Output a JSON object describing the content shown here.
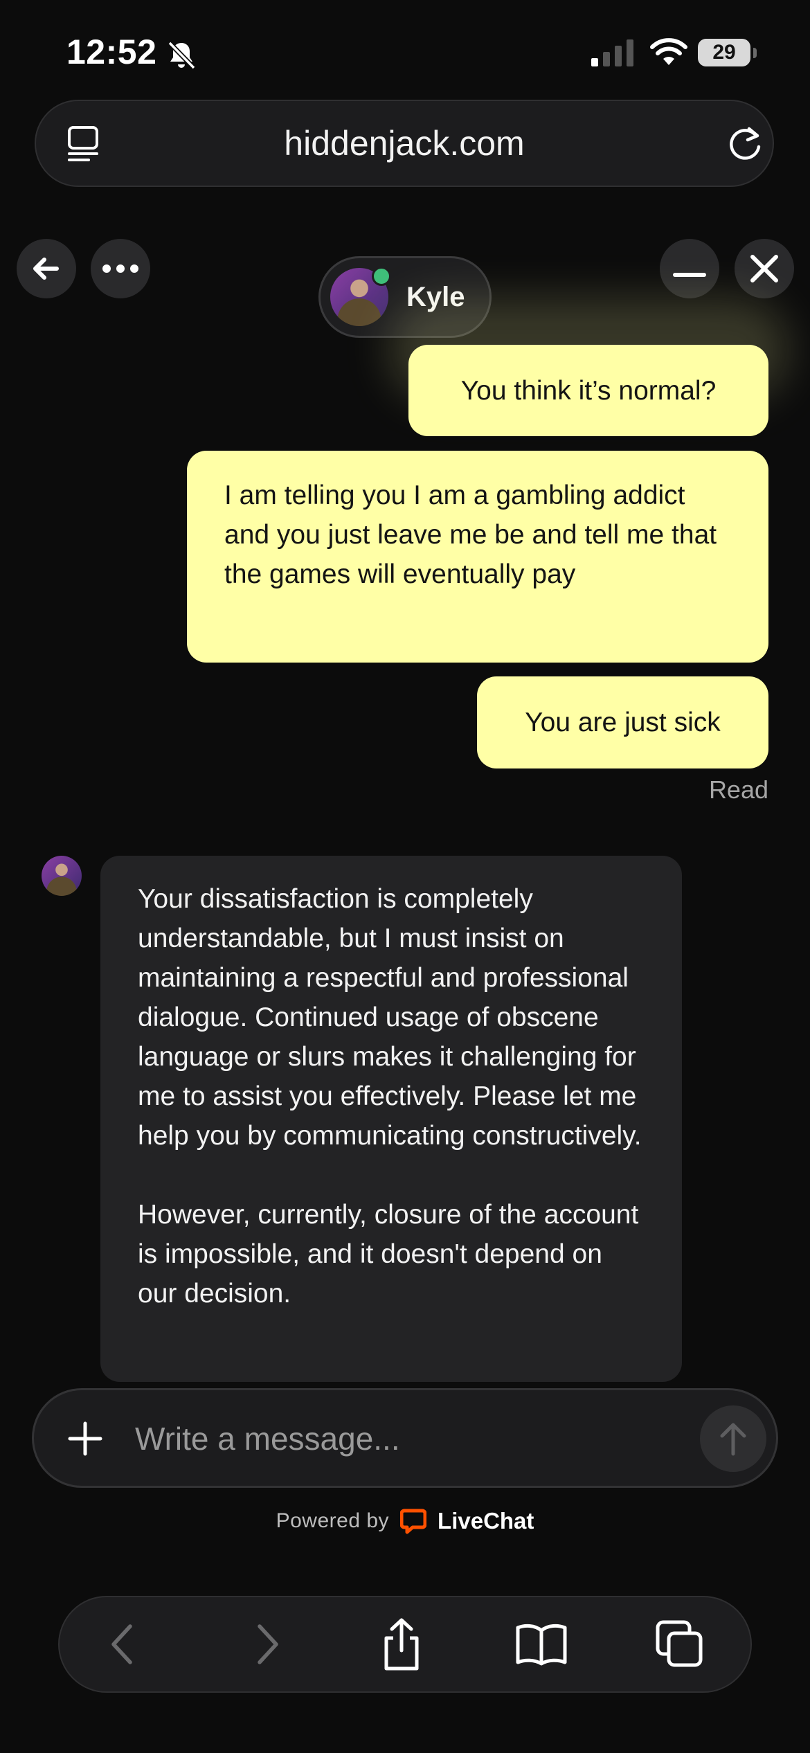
{
  "status_bar": {
    "time": "12:52",
    "battery": "29",
    "icons": [
      "bell-slash-icon",
      "cellular-signal-icon",
      "wifi-icon",
      "battery-icon"
    ]
  },
  "browser": {
    "url": "hiddenjack.com",
    "icons": [
      "tab-overview-icon",
      "reload-icon"
    ]
  },
  "chat_header": {
    "agent_name": "Kyle",
    "agent_status": "online",
    "icons": [
      "back-arrow-icon",
      "more-icon",
      "minimize-icon",
      "close-icon"
    ]
  },
  "messages": [
    {
      "from": "visitor",
      "text": "You think it’s normal?"
    },
    {
      "from": "visitor",
      "text": "I am telling you I am a gambling addict and you just leave me be and tell me that the games will eventually pay"
    },
    {
      "from": "visitor",
      "text": "You are just sick"
    },
    {
      "from": "agent",
      "paragraphs": [
        "Your dissatisfaction is completely understandable, but I must insist on maintaining a respectful and professional dialogue. Continued usage of obscene language or slurs makes it challenging for me to assist you effectively. Please let me help you by communicating constructively.",
        "However, currently, closure of the account is impossible, and it doesn't depend on our decision."
      ]
    }
  ],
  "read_receipt": "Read",
  "composer": {
    "placeholder": "Write a message...",
    "icons": [
      "plus-icon",
      "send-arrow-icon"
    ]
  },
  "footer": {
    "powered_by": "Powered by",
    "brand": "LiveChat",
    "brand_color": "#ff5100"
  },
  "toolbar": {
    "icons": [
      "back-icon",
      "forward-icon",
      "share-icon",
      "bookmarks-icon",
      "tabs-icon"
    ]
  },
  "colors": {
    "background": "#0c0c0c",
    "visitor_bubble": "#ffffa6",
    "agent_bubble": "#232325",
    "online": "#3fbf7a"
  }
}
